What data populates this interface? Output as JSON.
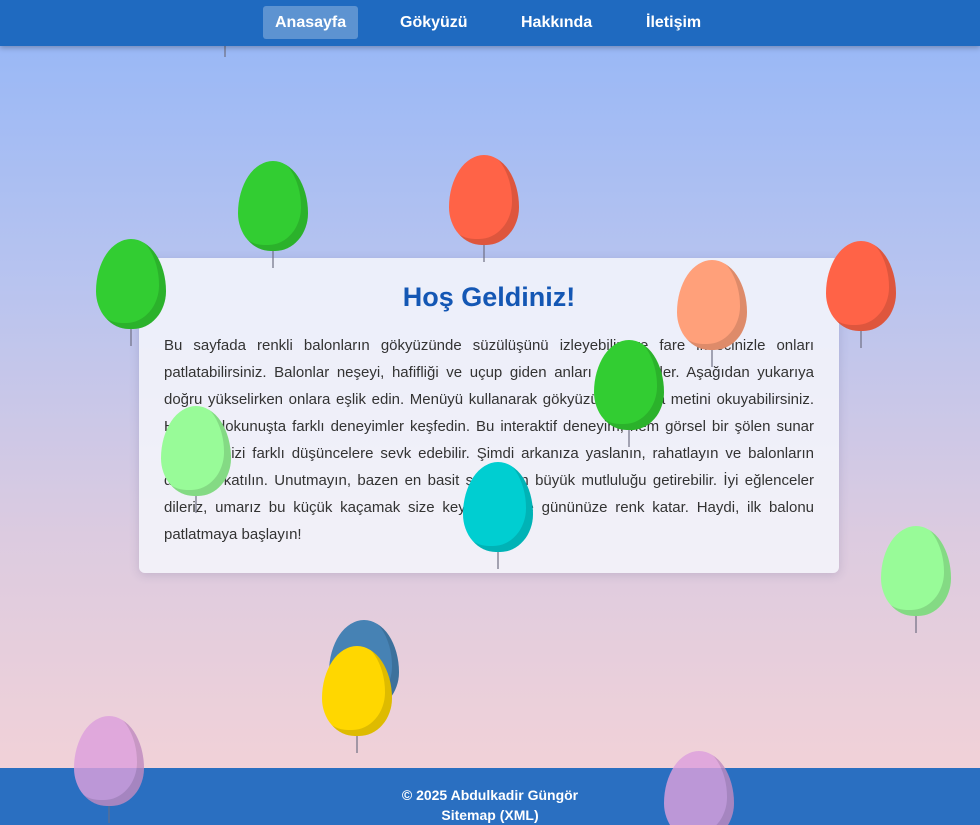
{
  "nav": {
    "items": [
      {
        "label": "Anasayfa",
        "active": true
      },
      {
        "label": "Gökyüzü",
        "active": false
      },
      {
        "label": "Hakkında",
        "active": false
      },
      {
        "label": "İletişim",
        "active": false
      }
    ]
  },
  "main": {
    "title": "Hoş Geldiniz!",
    "text": "Bu sayfada renkli balonların gökyüzünde süzülüşünü izleyebilir ve fare imlecinizle onları patlatabilirsiniz. Balonlar neşeyi, hafifliği ve uçup giden anları temsil eder. Aşağıdan yukarıya doğru yükselirken onlara eşlik edin. Menüyü kullanarak gökyüzü hakkında metini okuyabilirsiniz. Her bir dokunuşta farklı deneyimler keşfedin. Bu interaktif deneyim, hem görsel bir şölen sunar hem de sizi farklı düşüncelere sevk edebilir. Şimdi arkanıza yaslanın, rahatlayın ve balonların dansına katılın. Unutmayın, bazen en basit şeyler en büyük mutluluğu getirebilir. İyi eğlenceler dileriz, umarız bu küçük kaçamak size keyif verir ve gününüze renk katar. Haydi, ilk balonu patlatmaya başlayın!"
  },
  "footer": {
    "copyright": "© 2025 Abdulkadir Güngör",
    "sitemap_label": "Sitemap (XML)"
  },
  "balloons": [
    {
      "color": "#2e5cab"
    },
    {
      "color": "#32cd32"
    },
    {
      "color": "#ff6347"
    },
    {
      "color": "#32cd32"
    },
    {
      "color": "#ffa07a"
    },
    {
      "color": "#ff6347"
    },
    {
      "color": "#32cd32"
    },
    {
      "color": "#98fb98"
    },
    {
      "color": "#00ced1"
    },
    {
      "color": "#98fb98"
    },
    {
      "color": "#4682b4"
    },
    {
      "color": "#ffd700"
    },
    {
      "color": "#dda0dd"
    },
    {
      "color": "#dda0dd"
    }
  ]
}
